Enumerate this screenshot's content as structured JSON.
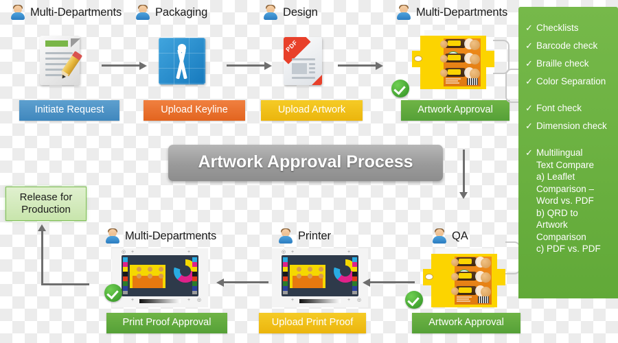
{
  "title_banner": {
    "text": "Artwork Approval Process"
  },
  "top_row": [
    {
      "actor": "Multi-Departments",
      "icon": "document-pencil-icon",
      "label": "Initiate Request",
      "color": "#4A8FC4"
    },
    {
      "actor": "Packaging",
      "icon": "blueprint-compass-icon",
      "label": "Upload Keyline",
      "color": "#E2641F"
    },
    {
      "actor": "Design",
      "icon": "pdf-document-icon",
      "label": "Upload Artwork",
      "color": "#EBB50D"
    },
    {
      "actor": "Multi-Departments",
      "icon": "carton-artwork-icon",
      "label": "Artwork Approval",
      "color": "#55A037",
      "approved": true
    }
  ],
  "bottom_row": [
    {
      "actor": "Multi-Departments",
      "icon": "press-proof-icon",
      "label": "Print Proof Approval",
      "color": "#55A037",
      "approved": true
    },
    {
      "actor": "Printer",
      "icon": "press-proof-icon",
      "label": "Upload Print Proof",
      "color": "#EBB50D"
    },
    {
      "actor": "QA",
      "icon": "carton-artwork-icon",
      "label": "Artwork Approval",
      "color": "#55A037",
      "approved": true
    }
  ],
  "release": {
    "line1": "Release for",
    "line2": "Production"
  },
  "checklist_panel": {
    "background": "#6CB33F",
    "group_one": [
      {
        "tick": "✓",
        "text": "Checklists"
      },
      {
        "tick": "✓",
        "text": "Barcode check"
      },
      {
        "tick": "✓",
        "text": "Braille check"
      },
      {
        "tick": "✓",
        "text": "Color Separation"
      }
    ],
    "group_two": [
      {
        "tick": "✓",
        "text": "Font check"
      },
      {
        "tick": "✓",
        "text": "Dimension check"
      }
    ],
    "group_three": {
      "tick": "✓",
      "lines": [
        "Multilingual",
        "Text Compare",
        "a) Leaflet",
        "Comparison –",
        "Word vs. PDF",
        "b) QRD to",
        "Artwork",
        "Comparison",
        "c) PDF vs. PDF"
      ]
    }
  },
  "pdf_ribbon_text": "PDF"
}
